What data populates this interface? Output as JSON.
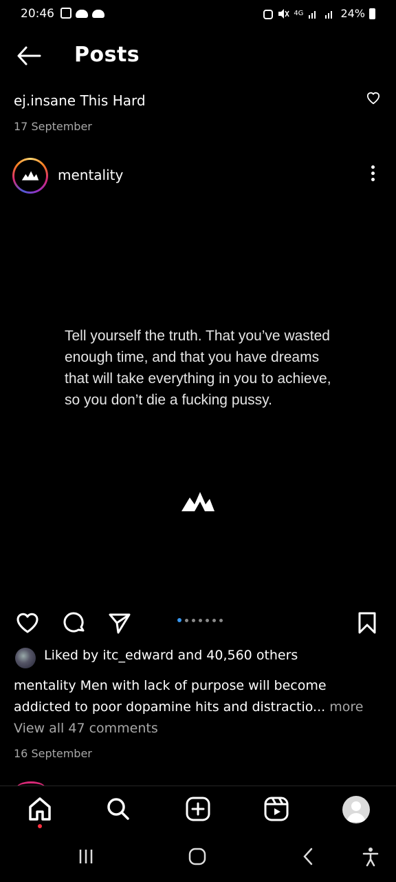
{
  "status_bar": {
    "time": "20:46",
    "network": "4G",
    "battery": "24%"
  },
  "header": {
    "title": "Posts"
  },
  "previous_post": {
    "caption": "ej.insane This Hard",
    "date": "17 September"
  },
  "post": {
    "username": "mentality",
    "quote": "Tell yourself the truth. That you’ve wasted enough time, and that you have dreams that will take everything in you to achieve, so you don’t die a fucking pussy.",
    "likes": "Liked by itc_edward and 40,560 others",
    "caption_username": "mentality",
    "caption_text": "Men with lack of purpose will become addicted to poor dopamine hits and distractio...",
    "caption_more": "more",
    "view_comments": "View all 47 comments",
    "date": "16 September",
    "carousel": {
      "count": 7,
      "active_index": 0
    }
  },
  "icons": {
    "back": "arrow-left-icon",
    "heart": "heart-icon",
    "comment": "comment-icon",
    "share": "send-icon",
    "save": "bookmark-icon",
    "home": "home-icon",
    "search": "search-icon",
    "create": "plus-square-icon",
    "reels": "reels-icon",
    "profile": "avatar",
    "more": "more-vertical-icon"
  },
  "colors": {
    "background": "#000000",
    "accent_blue": "#3897f0",
    "notification": "#ff3040",
    "muted_text": "#a8a8a8"
  }
}
